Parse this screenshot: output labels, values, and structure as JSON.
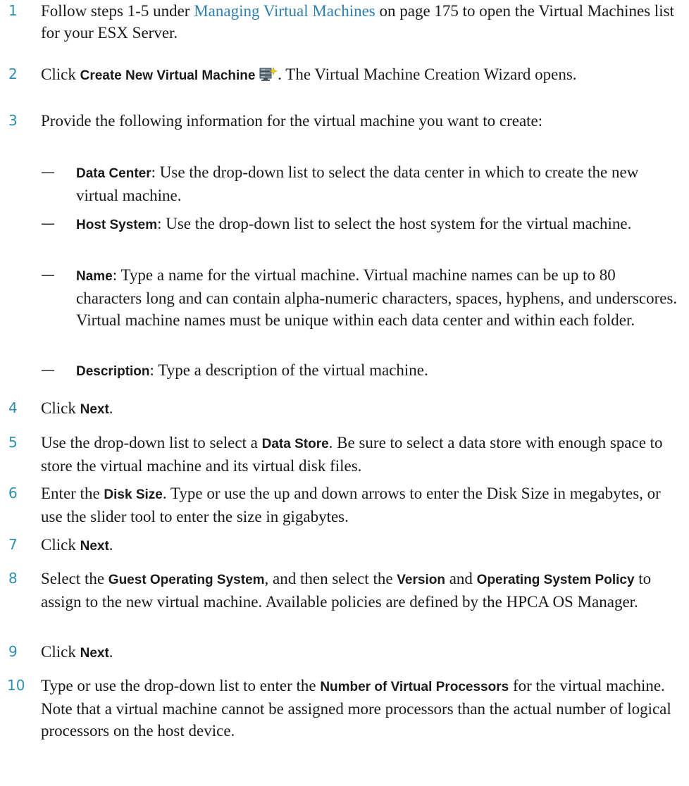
{
  "steps": [
    {
      "num": "1",
      "pre": "Follow steps 1-5 under ",
      "link": "Managing Virtual Machines",
      "post": " on page 175 to open the Virtual Machines list for your ESX Server."
    },
    {
      "num": "2",
      "pre": "Click ",
      "bold": "Create New Virtual Machine",
      "icon": "create-virtual-machine-icon",
      "post": ". The Virtual Machine Creation Wizard opens."
    },
    {
      "num": "3",
      "text": "Provide the following information for the virtual machine you want to create:"
    },
    {
      "num": "4",
      "pre": "Click ",
      "bold": "Next",
      "post": "."
    },
    {
      "num": "5",
      "pre": "Use the drop-down list to select a ",
      "bold": "Data Store",
      "post": ". Be sure to select a data store with enough space to store the virtual machine and its virtual disk files."
    },
    {
      "num": "6",
      "pre": "Enter the ",
      "bold": "Disk Size",
      "post": ". Type or use the up and down arrows to enter the Disk Size in megabytes, or use the slider tool to enter the size in gigabytes."
    },
    {
      "num": "7",
      "pre": "Click ",
      "bold": "Next",
      "post": "."
    },
    {
      "num": "8",
      "pre": "Select the ",
      "bold": "Guest Operating System",
      "mid": ", and then select the ",
      "bold2": "Version",
      "mid2": " and ",
      "bold3": "Operating System Policy",
      "post": " to assign to the new virtual machine. Available policies are defined by the HPCA OS Manager."
    },
    {
      "num": "9",
      "pre": "Click ",
      "bold": "Next",
      "post": "."
    },
    {
      "num": "10",
      "pre": "Type or use the drop-down list to enter the ",
      "bold": "Number of Virtual Processors",
      "post": " for the virtual machine. Note that a virtual machine cannot be assigned more processors than the actual number of logical processors on the host device."
    }
  ],
  "step3_items": [
    {
      "dash": "—",
      "term": "Data Center",
      "desc": ": Use the drop-down list to select the data center in which to create the new virtual machine."
    },
    {
      "dash": "—",
      "term": "Host System",
      "desc": ": Use the drop-down list to select the host system for the virtual machine."
    },
    {
      "dash": "—",
      "term": "Name",
      "desc": ": Type a name for the virtual machine. Virtual machine names can be up to 80 characters long and can contain alpha-numeric characters, spaces, hyphens, and underscores. Virtual machine names must be unique within each data center and within each folder."
    },
    {
      "dash": "—",
      "term": "Description",
      "desc": ": Type a description of the virtual machine."
    }
  ],
  "colors": {
    "accent": "#2f8fb3",
    "link": "#2f7fb0",
    "text": "#1a1a1a"
  }
}
